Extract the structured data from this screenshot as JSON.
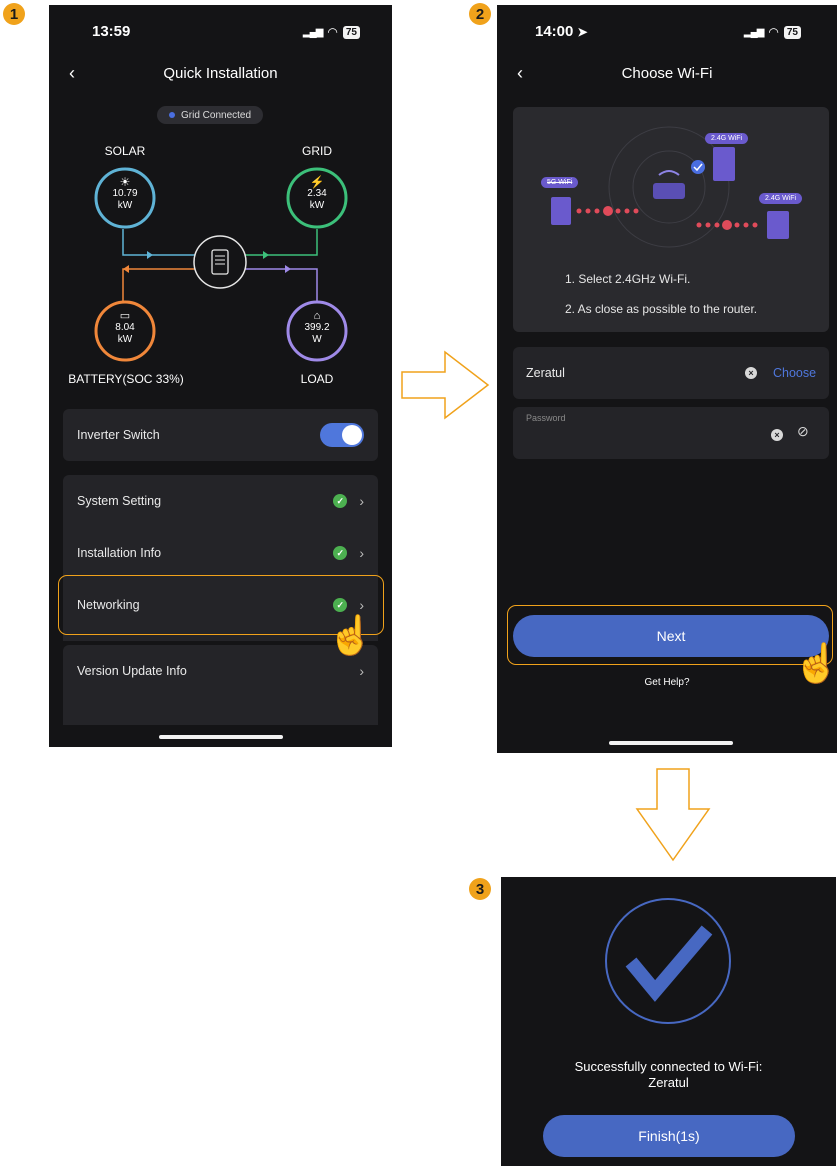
{
  "steps": [
    "1",
    "2",
    "3"
  ],
  "screen1": {
    "time": "13:59",
    "battery": "75",
    "title": "Quick Installation",
    "grid_status": "Grid Connected",
    "solar": {
      "label": "SOLAR",
      "value": "10.79",
      "unit": "kW"
    },
    "grid": {
      "label": "GRID",
      "value": "2.34",
      "unit": "kW"
    },
    "battery_node": {
      "label": "BATTERY(SOC 33%)",
      "value": "8.04",
      "unit": "kW"
    },
    "load": {
      "label": "LOAD",
      "value": "399.2",
      "unit": "W"
    },
    "inverter_switch": {
      "label": "Inverter Switch",
      "on": true
    },
    "menu": [
      {
        "label": "System Setting",
        "checked": true
      },
      {
        "label": "Installation Info",
        "checked": true
      },
      {
        "label": "Networking",
        "checked": true
      },
      {
        "label": "Version Update Info",
        "checked": false
      }
    ]
  },
  "screen2": {
    "time": "14:00",
    "battery": "75",
    "title": "Choose Wi-Fi",
    "illustration": {
      "tag_5g": "5G WiFi",
      "tag_24_top": "2.4G WiFi",
      "tag_24_right": "2.4G WiFi"
    },
    "instructions": [
      "1. Select 2.4GHz Wi-Fi.",
      "2. As close as possible to the router."
    ],
    "ssid_value": "Zeratul",
    "choose_label": "Choose",
    "password_label": "Password",
    "next_label": "Next",
    "help_label": "Get Help?"
  },
  "screen3": {
    "message_line1": "Successfully connected to Wi-Fi:",
    "message_line2": "Zeratul",
    "finish_label": "Finish(1s)"
  },
  "colors": {
    "accent": "#f0a21b",
    "primary_blue": "#4768c2",
    "solar": "#5fb3d6",
    "grid": "#3cc07a",
    "battery": "#f0873a",
    "load": "#9f8ae8",
    "phone_bg": "#141416"
  }
}
